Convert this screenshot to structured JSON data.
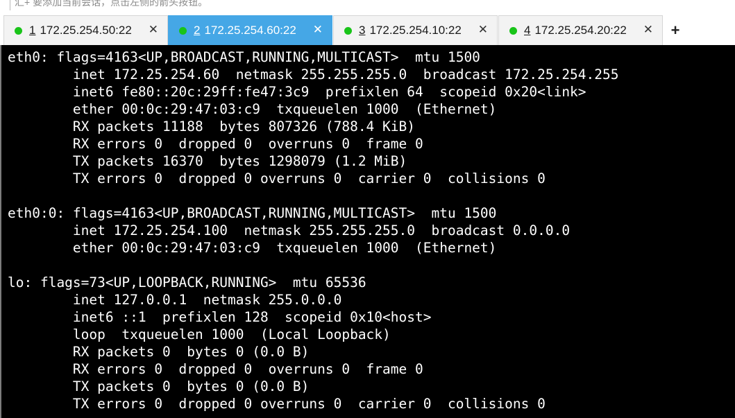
{
  "toolbar": {
    "hint_text": "汇+ 要添加当前会话，点击左侧的箭头按钮。"
  },
  "tabs": [
    {
      "number": "1",
      "address": "172.25.254.50:22",
      "active": false,
      "status_color": "#19c419"
    },
    {
      "number": "2",
      "address": "172.25.254.60:22",
      "active": true,
      "status_color": "#19c419"
    },
    {
      "number": "3",
      "address": "172.25.254.10:22",
      "active": false,
      "status_color": "#19c419"
    },
    {
      "number": "4",
      "address": "172.25.254.20:22",
      "active": false,
      "status_color": "#19c419"
    }
  ],
  "tab_close_glyph": "✕",
  "add_tab_glyph": "+",
  "terminal": {
    "lines": [
      "eth0: flags=4163<UP,BROADCAST,RUNNING,MULTICAST>  mtu 1500",
      "        inet 172.25.254.60  netmask 255.255.255.0  broadcast 172.25.254.255",
      "        inet6 fe80::20c:29ff:fe47:3c9  prefixlen 64  scopeid 0x20<link>",
      "        ether 00:0c:29:47:03:c9  txqueuelen 1000  (Ethernet)",
      "        RX packets 11188  bytes 807326 (788.4 KiB)",
      "        RX errors 0  dropped 0  overruns 0  frame 0",
      "        TX packets 16370  bytes 1298079 (1.2 MiB)",
      "        TX errors 0  dropped 0 overruns 0  carrier 0  collisions 0",
      "",
      "eth0:0: flags=4163<UP,BROADCAST,RUNNING,MULTICAST>  mtu 1500",
      "        inet 172.25.254.100  netmask 255.255.255.0  broadcast 0.0.0.0",
      "        ether 00:0c:29:47:03:c9  txqueuelen 1000  (Ethernet)",
      "",
      "lo: flags=73<UP,LOOPBACK,RUNNING>  mtu 65536",
      "        inet 127.0.0.1  netmask 255.0.0.0",
      "        inet6 ::1  prefixlen 128  scopeid 0x10<host>",
      "        loop  txqueuelen 1000  (Local Loopback)",
      "        RX packets 0  bytes 0 (0.0 B)",
      "        RX errors 0  dropped 0  overruns 0  frame 0",
      "        TX packets 0  bytes 0 (0.0 B)",
      "        TX errors 0  dropped 0 overruns 0  carrier 0  collisions 0"
    ]
  }
}
